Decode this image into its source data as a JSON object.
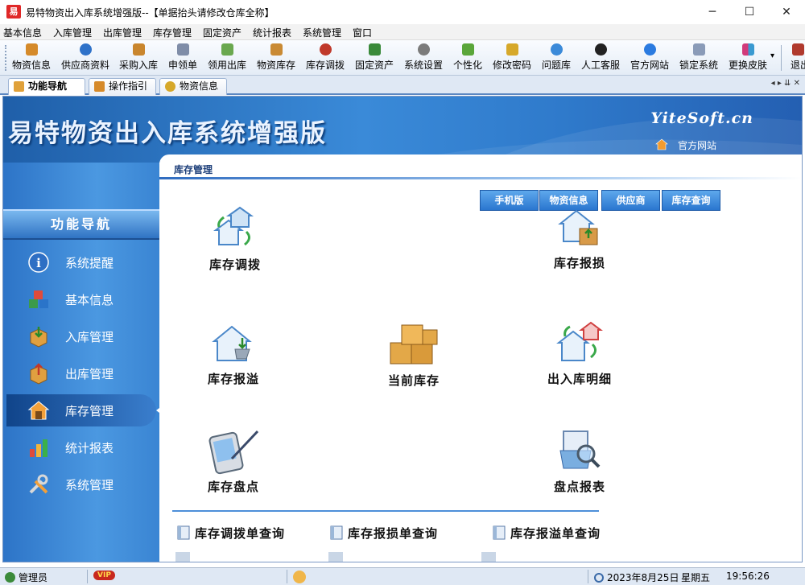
{
  "window": {
    "app_icon_text": "易",
    "title": "易特物资出入库系统增强版--【单据抬头请修改仓库全称】",
    "controls": [
      "─",
      "☐",
      "✕"
    ]
  },
  "menubar": [
    "基本信息",
    "入库管理",
    "出库管理",
    "库存管理",
    "固定资产",
    "统计报表",
    "系统管理",
    "窗口"
  ],
  "toolbar": {
    "items": [
      {
        "label": "物资信息",
        "color": "#d58a2a"
      },
      {
        "label": "供应商资料",
        "color": "#2f72c9"
      },
      {
        "label": "采购入库",
        "color": "#c9862e"
      },
      {
        "label": "申领单",
        "color": "#7f8da8"
      },
      {
        "label": "领用出库",
        "color": "#6aa84f"
      },
      {
        "label": "物资库存",
        "color": "#c98a34"
      },
      {
        "label": "库存调拨",
        "color": "#c0392b"
      },
      {
        "label": "固定资产",
        "color": "#3a8a3a"
      },
      {
        "label": "系统设置",
        "color": "#7b7b7b"
      },
      {
        "label": "个性化",
        "color": "#5aa63a"
      },
      {
        "label": "修改密码",
        "color": "#d6a82a"
      },
      {
        "label": "问题库",
        "color": "#3b8ad9"
      },
      {
        "label": "人工客服",
        "color": "#222222"
      },
      {
        "label": "官方网站",
        "color": "#2b7be0"
      },
      {
        "label": "锁定系统",
        "color": "#8a9bb8"
      },
      {
        "label": "更换皮肤",
        "color": "#d13a7a"
      }
    ],
    "overflow_label": "退出",
    "more_glyph": "▾"
  },
  "tabs": [
    {
      "label": "功能导航",
      "active": true,
      "color": "#e0a13a"
    },
    {
      "label": "操作指引",
      "active": false,
      "color": "#d68a2a"
    },
    {
      "label": "物资信息",
      "active": false,
      "color": "#d6a82a"
    }
  ],
  "tab_nav_glyphs": "◂ ▸ ⇊ ✕",
  "banner": {
    "title": "易特物资出入库系统增强版",
    "logo": "YiteSoft.cn",
    "site_link": "官方网站"
  },
  "sidebar": {
    "header": "功能导航",
    "items": [
      {
        "label": "系统提醒",
        "active": false
      },
      {
        "label": "基本信息",
        "active": false
      },
      {
        "label": "入库管理",
        "active": false
      },
      {
        "label": "出库管理",
        "active": false
      },
      {
        "label": "库存管理",
        "active": true
      },
      {
        "label": "统计报表",
        "active": false
      },
      {
        "label": "系统管理",
        "active": false
      }
    ]
  },
  "content": {
    "section_title": "库存管理",
    "tag_buttons": [
      "手机版",
      "物资信息",
      "供应商",
      "库存查询"
    ],
    "functions": [
      {
        "label": "库存调拨"
      },
      {
        "label": "库存报损"
      },
      {
        "label": "库存报溢"
      },
      {
        "label": "当前库存"
      },
      {
        "label": "出入库明细"
      },
      {
        "label": "库存盘点"
      },
      {
        "label": "盘点报表"
      }
    ],
    "queries": [
      "库存调拨单查询",
      "库存报损单查询",
      "库存报溢单查询"
    ]
  },
  "statusbar": {
    "user": "管理员",
    "vip": "VIP",
    "date": "2023年8月25日",
    "weekday": "星期五",
    "time": "19:56:26"
  }
}
